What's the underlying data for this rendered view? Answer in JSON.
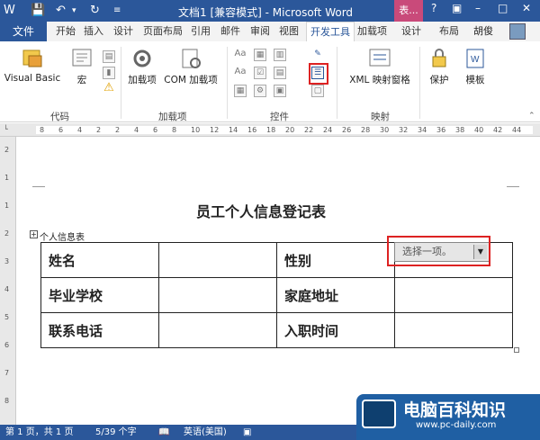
{
  "titlebar": {
    "title": "文档1 [兼容模式] - Microsoft Word",
    "context_tab": "表...",
    "win_controls": [
      "?",
      "▣",
      "–",
      "□",
      "✕"
    ]
  },
  "tabs": {
    "file": "文件",
    "items": [
      "开始",
      "插入",
      "设计",
      "页面布局",
      "引用",
      "邮件",
      "审阅",
      "视图",
      "开发工具",
      "加载项",
      "设计",
      "布局"
    ],
    "user": "胡俊"
  },
  "ribbon": {
    "visual_basic": "Visual Basic",
    "macro": "宏",
    "addins": "加载项",
    "com_addins": "COM 加载项",
    "xml_pane": "XML 映射窗格",
    "protect": "保护",
    "template": "模板",
    "group_labels": [
      "代码",
      "加载项",
      "控件",
      "映射"
    ]
  },
  "ruler_marks": [
    "8",
    "6",
    "4",
    "2",
    "2",
    "4",
    "6",
    "8",
    "10",
    "12",
    "14",
    "16",
    "18",
    "20",
    "22",
    "24",
    "26",
    "28",
    "30",
    "32",
    "34",
    "36",
    "38",
    "40",
    "42",
    "44"
  ],
  "vruler_marks": [
    "2",
    "1",
    "1",
    "2",
    "3",
    "4",
    "5",
    "6",
    "7",
    "8"
  ],
  "document": {
    "title": "员工个人信息登记表",
    "caption": "个人信息表",
    "rows": [
      [
        "姓名",
        "",
        "性别",
        ""
      ],
      [
        "毕业学校",
        "",
        "家庭地址",
        ""
      ],
      [
        "联系电话",
        "",
        "入职时间",
        ""
      ]
    ],
    "dropdown_placeholder": "选择一项。"
  },
  "statusbar": {
    "page": "第 1 页，共 1 页",
    "words": "5/39 个字",
    "lang": "英语(美国)"
  },
  "watermark": {
    "text": "电脑百科知识",
    "url": "www.pc-daily.com"
  },
  "colors": {
    "accent": "#2b579a",
    "context_tab": "#c94a7a",
    "highlight": "#d22222"
  }
}
